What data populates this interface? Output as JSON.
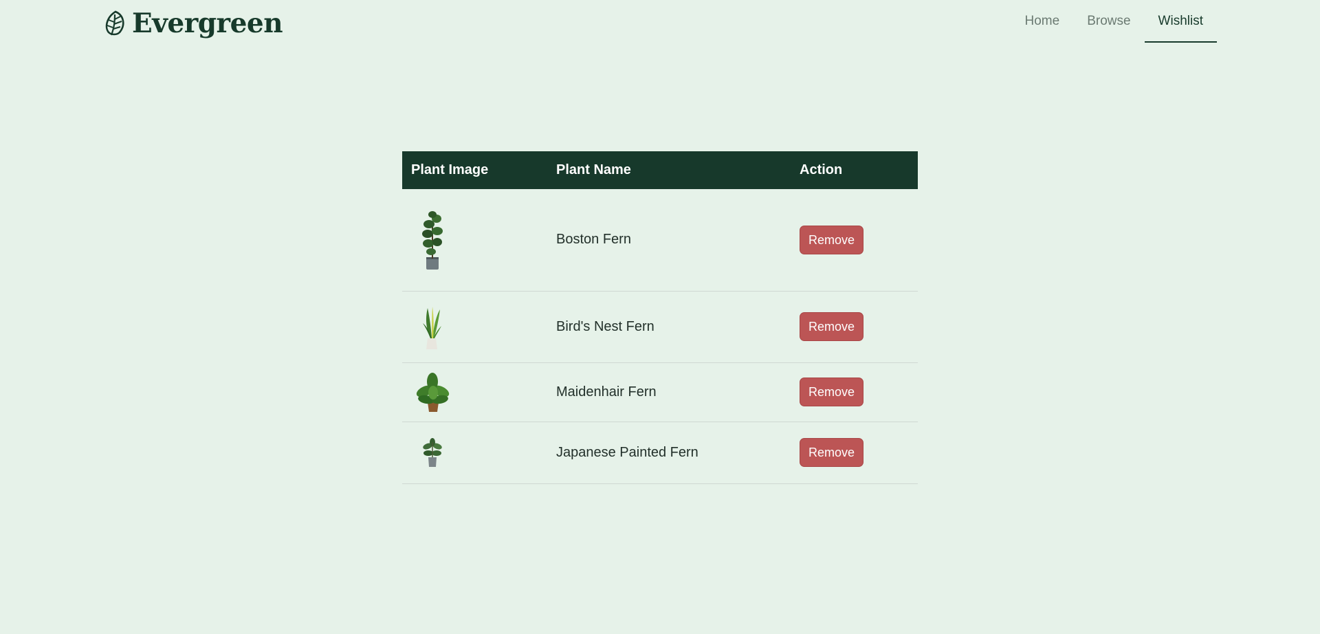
{
  "brand": {
    "name": "Evergreen",
    "color": "#173a2b"
  },
  "nav": {
    "items": [
      {
        "label": "Home",
        "active": false
      },
      {
        "label": "Browse",
        "active": false
      },
      {
        "label": "Wishlist",
        "active": true
      }
    ]
  },
  "wishlist_table": {
    "headers": {
      "image": "Plant Image",
      "name": "Plant Name",
      "action": "Action"
    },
    "rows": [
      {
        "name": "Boston Fern",
        "action_label": "Remove",
        "image_icon": "fiddle-leaf-plant-icon"
      },
      {
        "name": "Bird's Nest Fern",
        "action_label": "Remove",
        "image_icon": "snake-plant-icon"
      },
      {
        "name": "Maidenhair Fern",
        "action_label": "Remove",
        "image_icon": "leafy-plant-icon"
      },
      {
        "name": "Japanese Painted Fern",
        "action_label": "Remove",
        "image_icon": "small-potted-plant-icon"
      }
    ]
  },
  "colors": {
    "background": "#e6f2e9",
    "header_row": "#17392b",
    "remove_button": "#bc5555"
  }
}
